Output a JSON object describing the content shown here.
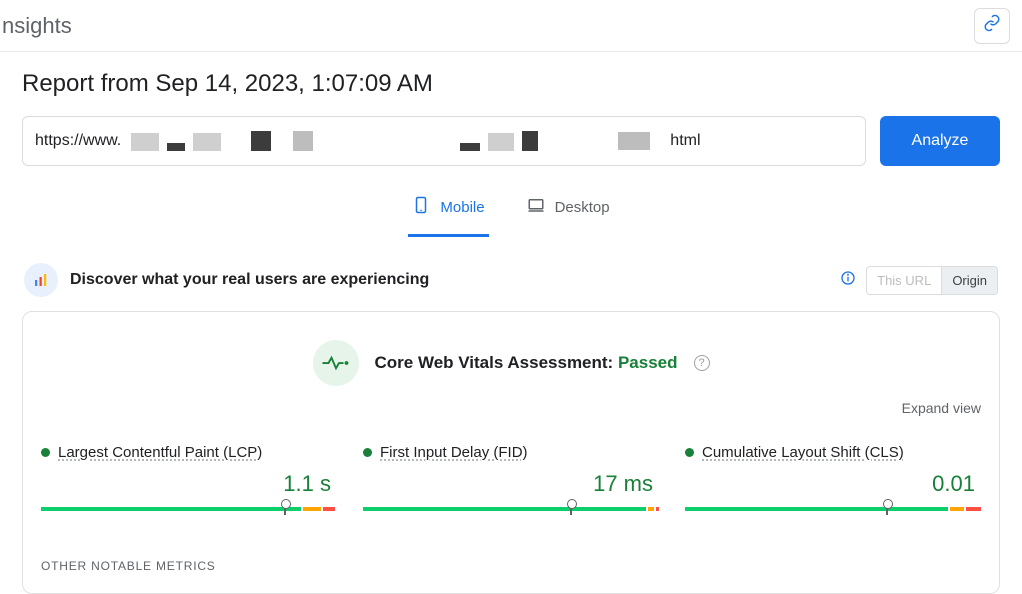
{
  "header": {
    "app_title": "nsights"
  },
  "report": {
    "title": "Report from Sep 14, 2023, 1:07:09 AM"
  },
  "url_bar": {
    "prefix": "https://www.",
    "suffix": "html"
  },
  "actions": {
    "analyze": "Analyze"
  },
  "tabs": {
    "mobile": "Mobile",
    "desktop": "Desktop"
  },
  "discover": {
    "text": "Discover what your real users are experiencing"
  },
  "segments": {
    "this_url": "This URL",
    "origin": "Origin"
  },
  "cwv": {
    "label": "Core Web Vitals Assessment: ",
    "status": "Passed"
  },
  "expand": {
    "label": "Expand view"
  },
  "metrics": {
    "lcp": {
      "name": "Largest Contentful Paint (LCP)",
      "value": "1.1 s"
    },
    "fid": {
      "name": "First Input Delay (FID)",
      "value": "17 ms"
    },
    "cls": {
      "name": "Cumulative Layout Shift (CLS)",
      "value": "0.01"
    }
  },
  "other": {
    "label": "OTHER NOTABLE METRICS"
  },
  "chart_data": [
    {
      "type": "bar",
      "metric": "LCP",
      "value": 1.1,
      "unit": "s",
      "segments_pct": {
        "good": 88,
        "needs_improvement": 6,
        "poor": 4
      },
      "marker_pct": 82
    },
    {
      "type": "bar",
      "metric": "FID",
      "value": 17,
      "unit": "ms",
      "segments_pct": {
        "good": 97,
        "needs_improvement": 2,
        "poor": 1
      },
      "marker_pct": 70
    },
    {
      "type": "bar",
      "metric": "CLS",
      "value": 0.01,
      "unit": "",
      "segments_pct": {
        "good": 90,
        "needs_improvement": 5,
        "poor": 5
      },
      "marker_pct": 68
    }
  ]
}
